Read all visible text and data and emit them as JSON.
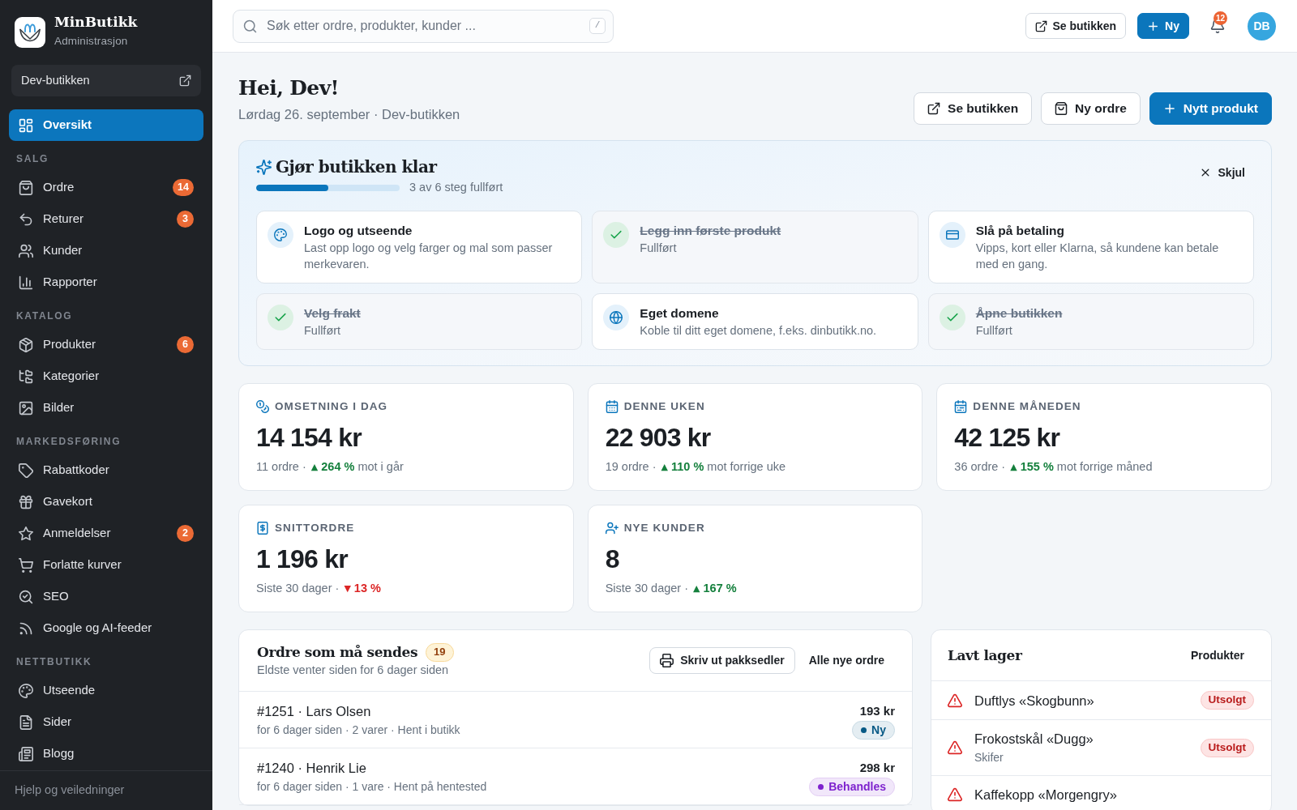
{
  "sidebar": {
    "brand": {
      "name": "MinButikk",
      "subtitle": "Administrasjon"
    },
    "store": {
      "label": "Dev-butikken"
    },
    "sections": [
      {
        "items": [
          {
            "label": "Oversikt",
            "selected": true
          }
        ]
      },
      {
        "heading": "SALG",
        "items": [
          {
            "label": "Ordre",
            "badge": "14",
            "selected": false
          },
          {
            "label": "Returer",
            "badge": "3",
            "selected": false
          },
          {
            "label": "Kunder",
            "selected": false
          },
          {
            "label": "Rapporter",
            "selected": false
          }
        ]
      },
      {
        "heading": "KATALOG",
        "items": [
          {
            "label": "Produkter",
            "badge": "6",
            "selected": false
          },
          {
            "label": "Kategorier",
            "selected": false
          },
          {
            "label": "Bilder",
            "selected": false
          }
        ]
      },
      {
        "heading": "MARKEDSFØRING",
        "items": [
          {
            "label": "Rabattkoder",
            "selected": false
          },
          {
            "label": "Gavekort",
            "selected": false
          },
          {
            "label": "Anmeldelser",
            "badge": "2",
            "selected": false
          },
          {
            "label": "Forlatte kurver",
            "selected": false
          },
          {
            "label": "SEO",
            "selected": false
          },
          {
            "label": "Google og AI-feeder",
            "selected": false
          }
        ]
      },
      {
        "heading": "NETTBUTIKK",
        "items": [
          {
            "label": "Utseende",
            "selected": false
          },
          {
            "label": "Sider",
            "selected": false
          },
          {
            "label": "Blogg",
            "selected": false
          }
        ]
      }
    ],
    "footer_link": "Hjelp og veiledninger"
  },
  "topbar": {
    "search": {
      "placeholder": "Søk etter ordre, produkter, kunder ...",
      "shortcut": "/"
    },
    "buttons": [
      {
        "label": "Se butikken",
        "kind": "secondary"
      },
      {
        "label": "Ny",
        "kind": "primary"
      }
    ],
    "notifications": {
      "count": "12"
    },
    "avatar": {
      "initials": "DB"
    }
  },
  "page": {
    "title": "Hei, Dev!",
    "subtitle": "Lørdag 26. september · Dev-butikken",
    "actions": [
      {
        "label": "Se butikken",
        "kind": "secondary"
      },
      {
        "label": "Ny ordre",
        "kind": "secondary"
      },
      {
        "label": "Nytt produkt",
        "kind": "primary"
      }
    ]
  },
  "setup": {
    "title": "Gjør butikken klar",
    "progress": {
      "level": 0.5,
      "text": "3 av 6 steg fullført"
    },
    "dismiss": "Skjul",
    "steps": [
      {
        "title": "Logo og utseende",
        "description": "Last opp logo og velg farger og mal som passer merkevaren.",
        "done": false
      },
      {
        "title": "Legg inn første produkt",
        "description": "Fullført",
        "done": true
      },
      {
        "title": "Slå på betaling",
        "description": "Vipps, kort eller Klarna, så kundene kan betale med en gang.",
        "done": false
      },
      {
        "title": "Velg frakt",
        "description": "Fullført",
        "done": true
      },
      {
        "title": "Eget domene",
        "description": "Koble til ditt eget domene, f.eks. dinbutikk.no.",
        "done": false
      },
      {
        "title": "Åpne butikken",
        "description": "Fullført",
        "done": true
      }
    ]
  },
  "stats": [
    {
      "label": "OMSETNING I DAG",
      "value": "14 154 kr",
      "meta": "11 ordre ·",
      "arrow": "▲",
      "change": "264 %",
      "color": "#15803d",
      "comparison": "mot i går"
    },
    {
      "label": "DENNE UKEN",
      "value": "22 903 kr",
      "meta": "19 ordre ·",
      "arrow": "▲",
      "change": "110 %",
      "color": "#15803d",
      "comparison": "mot forrige uke"
    },
    {
      "label": "DENNE MÅNEDEN",
      "value": "42 125 kr",
      "meta": "36 ordre ·",
      "arrow": "▲",
      "change": "155 %",
      "color": "#15803d",
      "comparison": "mot forrige måned"
    },
    {
      "label": "SNITTORDRE",
      "value": "1 196 kr",
      "meta": "Siste 30 dager ·",
      "arrow": "▼",
      "change": "13 %",
      "color": "#dc2626"
    },
    {
      "label": "NYE KUNDER",
      "value": "8",
      "meta": "Siste 30 dager ·",
      "arrow": "▲",
      "change": "167 %",
      "color": "#15803d"
    }
  ],
  "orders": {
    "title": "Ordre som må sendes",
    "count": "19",
    "subtitle": "Eldste venter siden for 6 dager siden",
    "actions": [
      {
        "label": "Skriv ut pakksedler",
        "kind": "secondary"
      },
      {
        "label": "Alle nye ordre",
        "kind": "link"
      }
    ],
    "rows": [
      {
        "title": "#1251 · Lars Olsen",
        "details": "for 6 dager siden · 2 varer · Hent i butikk",
        "amount": "193 kr",
        "status": {
          "label": "Ny",
          "color": "#075985"
        }
      },
      {
        "title": "#1240 · Henrik Lie",
        "details": "for 6 dager siden · 1 vare · Hent på hentested",
        "amount": "298 kr",
        "status": {
          "label": "Behandles",
          "color": "#7e22ce"
        }
      }
    ]
  },
  "low_stock": {
    "title": "Lavt lager",
    "link": "Produkter",
    "items": [
      {
        "name": "Duftlys «Skogbunn»",
        "status": "Utsolgt"
      },
      {
        "name": "Frokostskål «Dugg»",
        "variant": "Skifer",
        "status": "Utsolgt"
      },
      {
        "name": "Kaffekopp «Morgengry»"
      }
    ]
  }
}
